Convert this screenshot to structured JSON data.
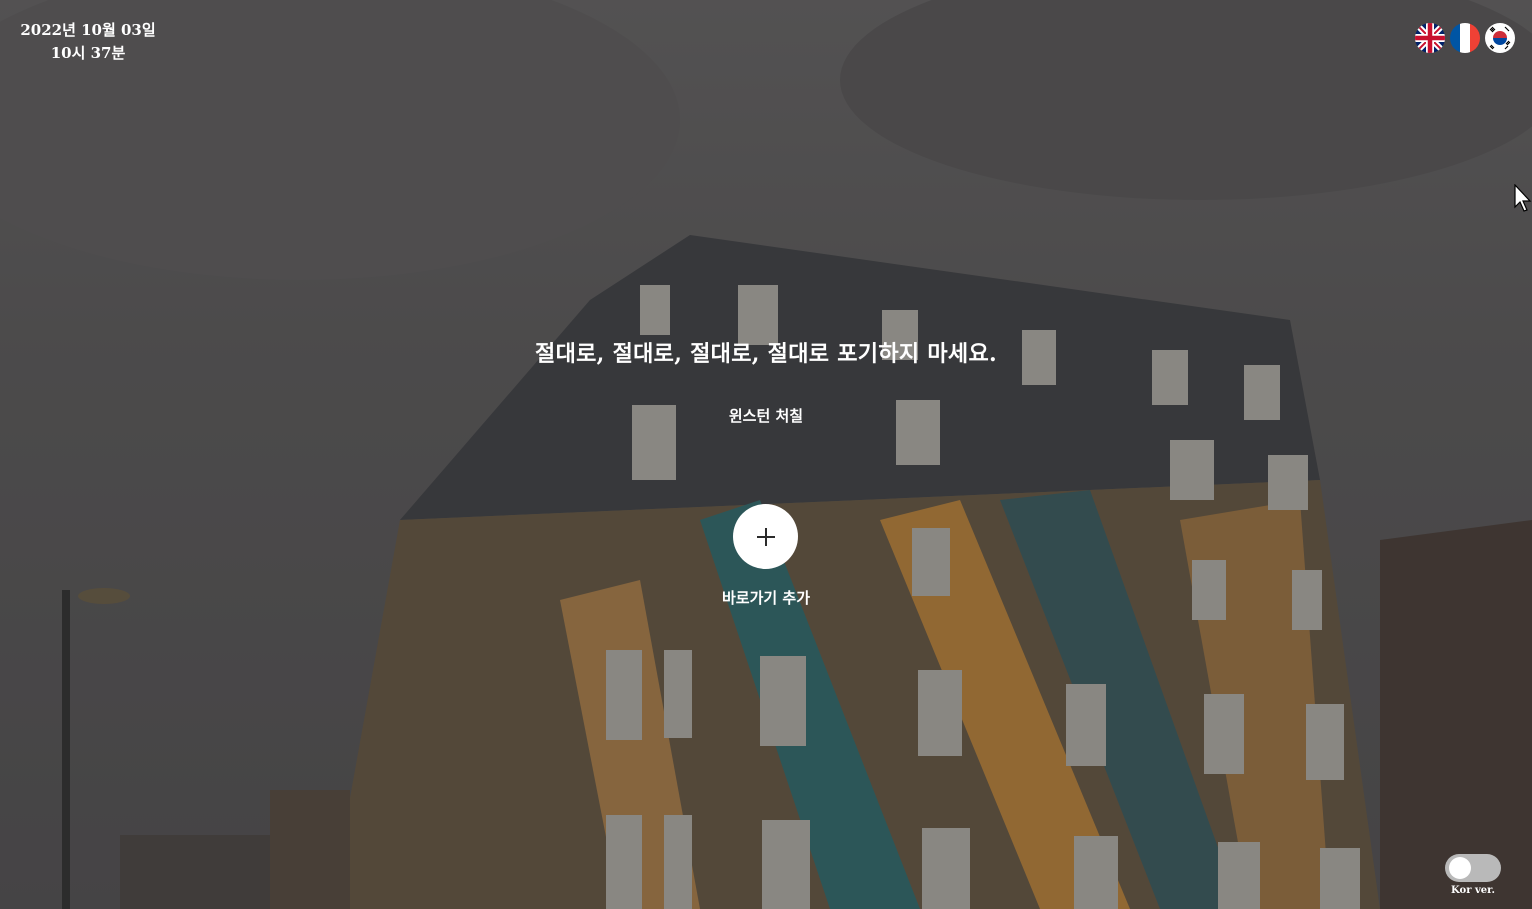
{
  "datetime": {
    "date": "2022년 10월 03일",
    "time": "10시 37분"
  },
  "languages": [
    {
      "name": "english-flag-icon",
      "code": "en"
    },
    {
      "name": "french-flag-icon",
      "code": "fr"
    },
    {
      "name": "korean-flag-icon",
      "code": "ko"
    }
  ],
  "quote": {
    "text": "절대로, 절대로, 절대로, 절대로 포기하지 마세요.",
    "author": "윈스턴 처칠"
  },
  "shortcut": {
    "icon": "plus-icon",
    "label": "바로가기 추가"
  },
  "toggle": {
    "label": "Kor ver.",
    "state": "off"
  },
  "colors": {
    "text": "#ffffff",
    "button": "#ffffff",
    "toggle_track": "#b9b9b9"
  }
}
